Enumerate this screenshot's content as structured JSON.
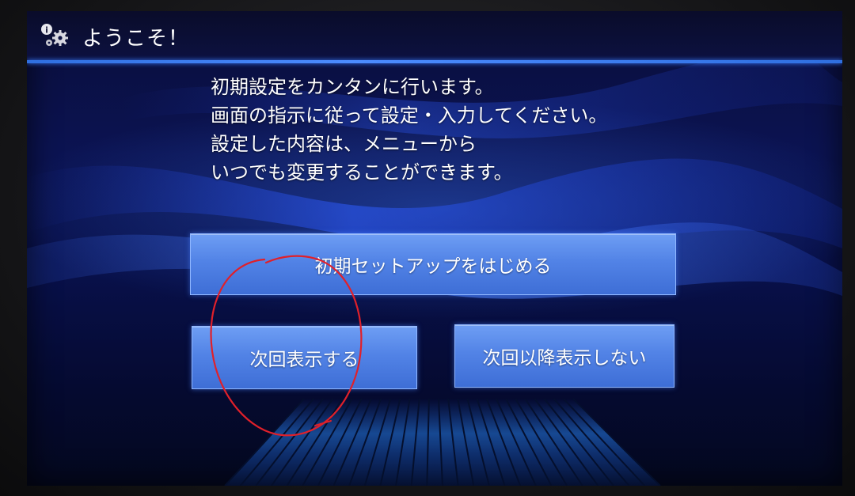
{
  "header": {
    "title": "ようこそ！",
    "icon": "gears-info-icon"
  },
  "message": {
    "lines": [
      "初期設定をカンタンに行います。",
      "画面の指示に従って設定・入力してください。",
      "設定した内容は、メニューから",
      "いつでも変更することができます。"
    ]
  },
  "buttons": {
    "start_setup": "初期セットアップをはじめる",
    "show_next_time": "次回表示する",
    "do_not_show_again": "次回以降表示しない"
  },
  "colors": {
    "background": "#0b1352",
    "button": "#5283e6",
    "accent_line": "#3a7cff",
    "annotation_circle": "#e0202a"
  }
}
